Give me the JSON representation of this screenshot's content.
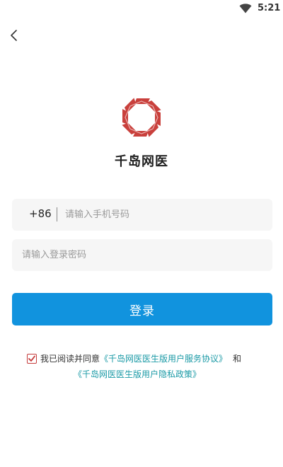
{
  "status_bar": {
    "time": "5:21",
    "icons": [
      "wifi-icon"
    ]
  },
  "nav": {
    "back_icon": "chevron-left-icon"
  },
  "brand": {
    "logo_icon": "octagon-logo",
    "logo_color": "#c9403c",
    "app_name": "千岛网医"
  },
  "form": {
    "country_code": "+86",
    "phone_placeholder": "请输入手机号码",
    "phone_value": "",
    "password_placeholder": "请输入登录密码",
    "password_value": "",
    "login_label": "登录",
    "login_color": "#1193de"
  },
  "agreement": {
    "checked": true,
    "prefix": "我已阅读并同意",
    "terms_link": "《千岛网医医生版用户服务协议》",
    "conjunction": "和",
    "privacy_link": "《千岛网医医生版用户隐私政策》",
    "link_color": "#1b9aa6"
  }
}
